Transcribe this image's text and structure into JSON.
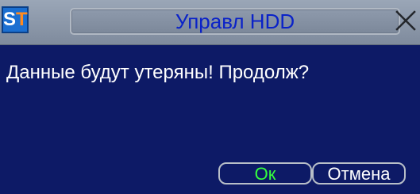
{
  "window": {
    "title": "Управл HDD",
    "app_icon_letters": [
      "S",
      "T"
    ],
    "close_icon": "close-icon"
  },
  "dialog": {
    "message": "Данные будут утеряны! Продолж?"
  },
  "buttons": {
    "ok_label": "Ок",
    "cancel_label": "Отмена"
  },
  "colors": {
    "background": "#0d1a66",
    "title_text": "#0a22c8",
    "ok_text": "#35ff3e",
    "text": "#ffffff"
  }
}
